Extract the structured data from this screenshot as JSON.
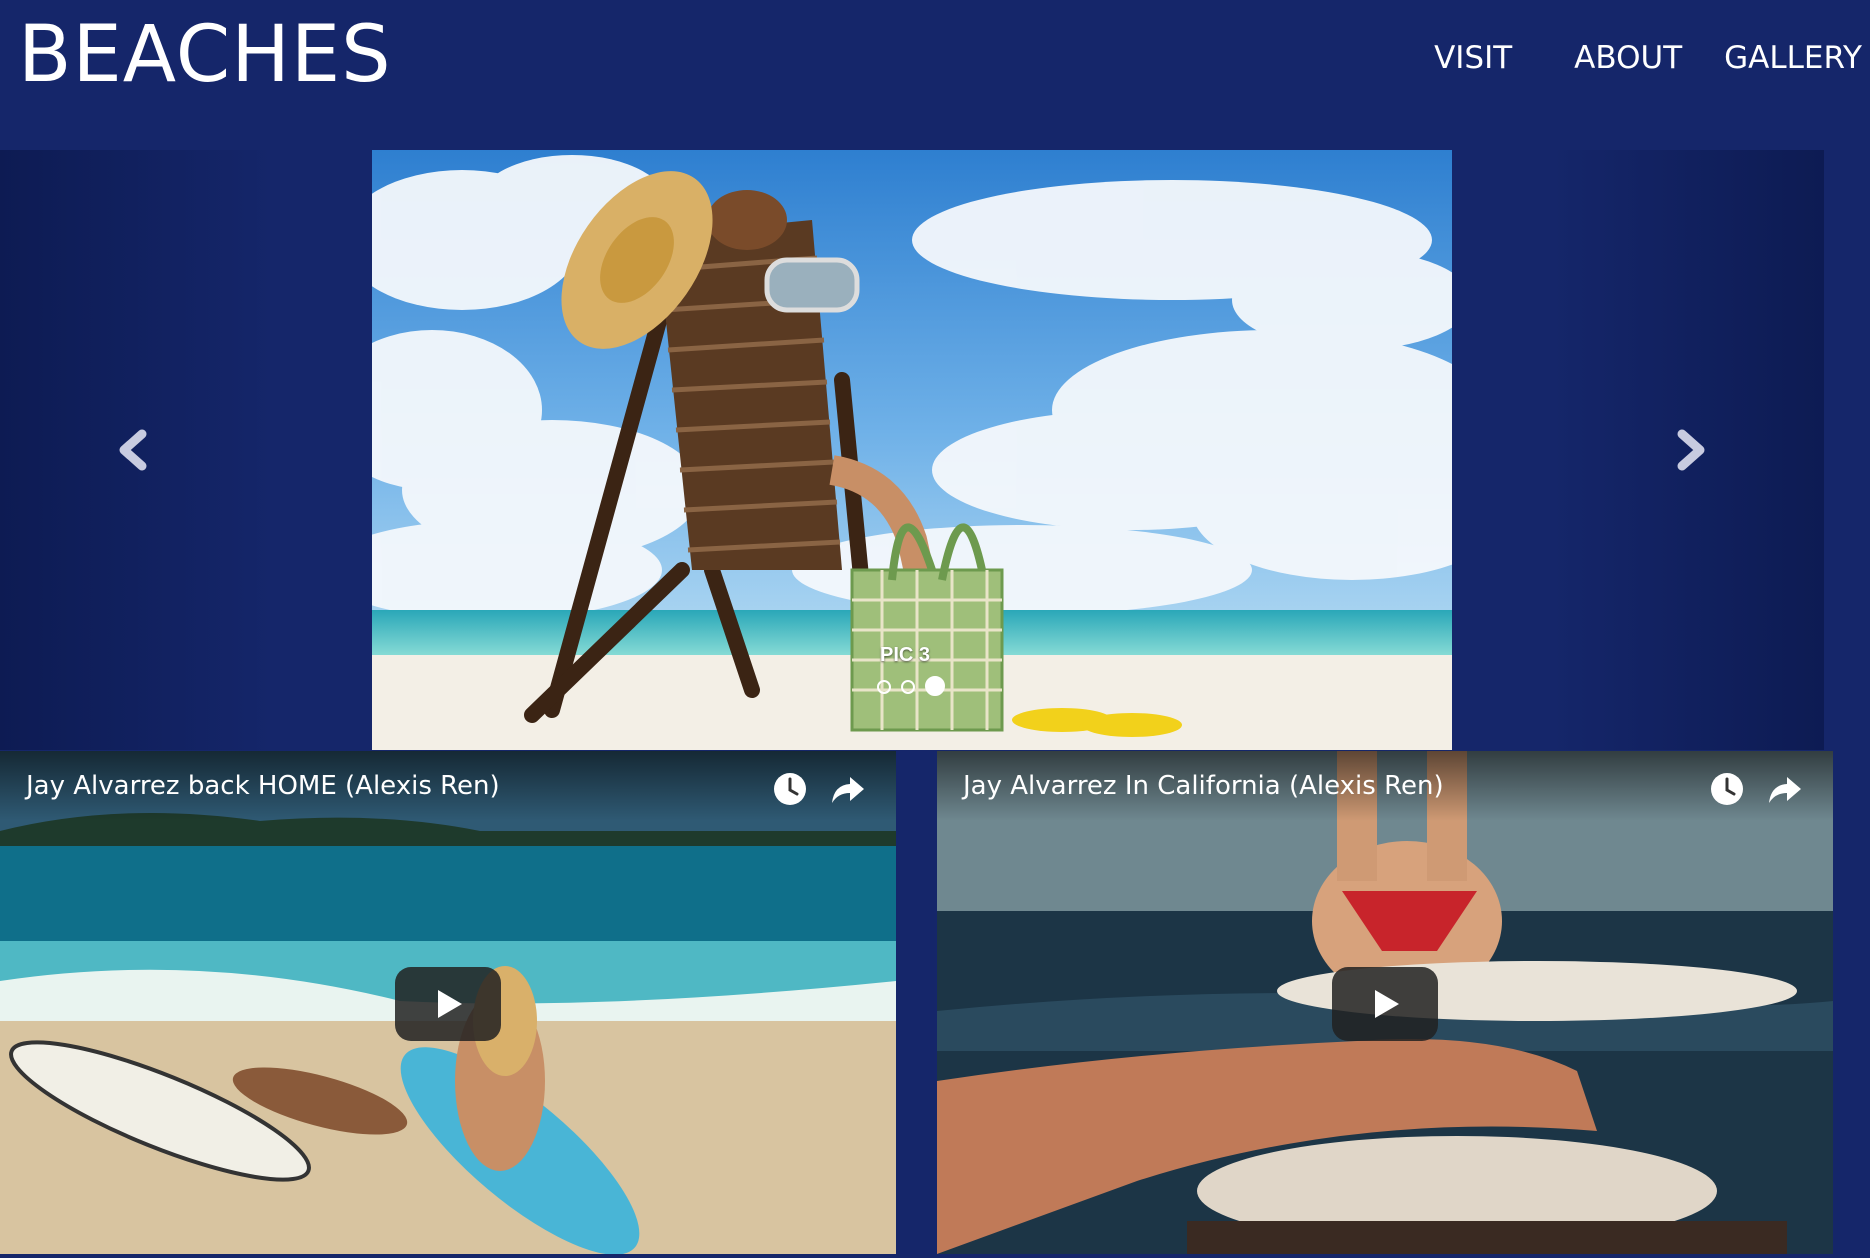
{
  "header": {
    "title": "BEACHES",
    "nav": [
      "VISIT",
      "ABOUT",
      "GALLERY"
    ]
  },
  "carousel": {
    "caption": "PIC 3",
    "slide_count": 3,
    "active_index": 2,
    "prev_icon": "chevron-left-icon",
    "next_icon": "chevron-right-icon"
  },
  "videos": [
    {
      "title": "Jay Alvarrez back HOME (Alexis Ren)"
    },
    {
      "title": "Jay Alvarrez In California (Alexis Ren)"
    }
  ],
  "colors": {
    "background": "#15266a",
    "text": "#ffffff"
  }
}
